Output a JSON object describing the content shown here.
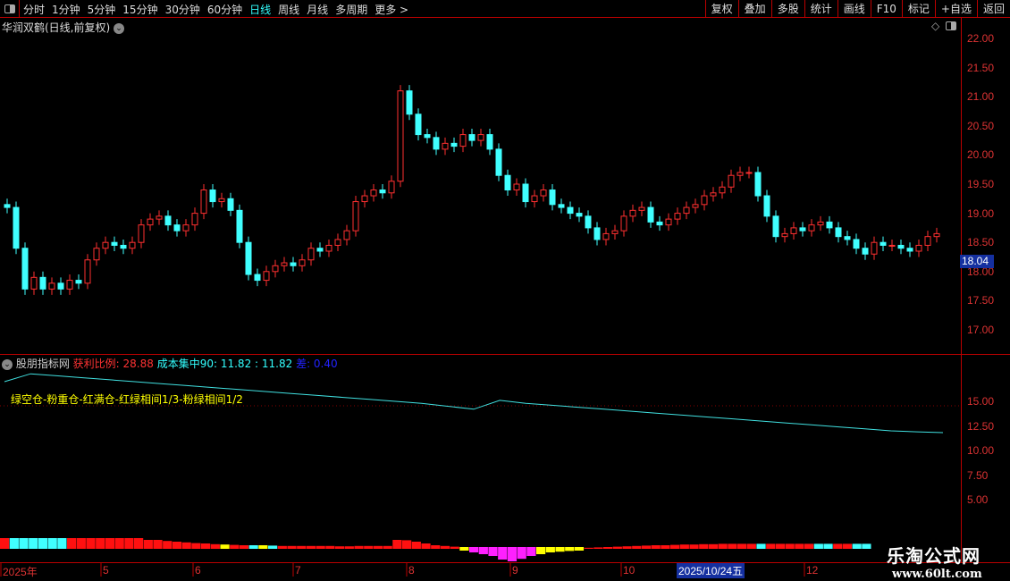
{
  "toolbar": {
    "periods": [
      "分时",
      "1分钟",
      "5分钟",
      "15分钟",
      "30分钟",
      "60分钟",
      "日线",
      "周线",
      "月线",
      "多周期",
      "更多 >"
    ],
    "active": "日线",
    "right_buttons": [
      "复权",
      "叠加",
      "多股",
      "统计",
      "画线",
      "F10",
      "标记",
      "+自选",
      "返回"
    ]
  },
  "stock": {
    "title": "华润双鹤(日线,前复权)",
    "current_price": "18.04"
  },
  "indicator": {
    "name": "股朋指标网",
    "profit_label": "获利比例: 28.88",
    "cost_label": "成本集中90: 11.82 : 11.82",
    "diff_label": "差: 0.40",
    "note": "绿空仓-粉重仓-红满仓-红绿相间1/3-粉绿相间1/2"
  },
  "colors": {
    "up": "#ff3030",
    "down": "#40ffff",
    "axis": "#b00000",
    "line": "#40e0e0",
    "pink": "#ff20ff",
    "yellow": "#ffff00",
    "blue": "#1530a0"
  },
  "chart_data": [
    {
      "type": "candlestick",
      "ylim": [
        16.8,
        22.2
      ],
      "yticks": [
        "22.00",
        "21.50",
        "21.00",
        "20.50",
        "20.00",
        "19.50",
        "19.00",
        "18.50",
        "18.00",
        "17.50",
        "17.00"
      ],
      "closes": [
        19.1,
        18.4,
        17.7,
        17.9,
        17.7,
        17.8,
        17.7,
        17.85,
        17.8,
        18.2,
        18.4,
        18.5,
        18.45,
        18.4,
        18.5,
        18.8,
        18.9,
        18.95,
        18.8,
        18.7,
        18.8,
        19.0,
        19.4,
        19.2,
        19.25,
        19.05,
        18.5,
        17.95,
        17.85,
        18.0,
        18.1,
        18.15,
        18.1,
        18.2,
        18.4,
        18.35,
        18.45,
        18.55,
        18.7,
        19.2,
        19.3,
        19.4,
        19.35,
        19.55,
        21.1,
        20.7,
        20.35,
        20.3,
        20.1,
        20.2,
        20.15,
        20.35,
        20.25,
        20.35,
        20.1,
        19.65,
        19.4,
        19.5,
        19.2,
        19.3,
        19.4,
        19.15,
        19.1,
        19.0,
        18.95,
        18.75,
        18.55,
        18.65,
        18.7,
        18.95,
        19.05,
        19.1,
        18.85,
        18.8,
        18.9,
        19.0,
        19.1,
        19.15,
        19.3,
        19.35,
        19.45,
        19.65,
        19.7,
        19.7,
        19.3,
        18.95,
        18.6,
        18.65,
        18.75,
        18.7,
        18.8,
        18.85,
        18.75,
        18.6,
        18.55,
        18.4,
        18.3,
        18.5,
        18.45,
        18.45,
        18.4,
        18.35,
        18.45,
        18.6,
        18.65
      ]
    },
    {
      "type": "line",
      "ylim": [
        3,
        18
      ],
      "yticks": [
        "15.00",
        "12.50",
        "10.00",
        "7.50",
        "5.00"
      ],
      "values": [
        17.0,
        17.8,
        17.6,
        17.4,
        17.2,
        17.0,
        16.8,
        16.6,
        16.4,
        16.2,
        16.0,
        15.8,
        15.6,
        15.4,
        15.2,
        15.0,
        14.8,
        14.5,
        14.2,
        15.1,
        14.8,
        14.6,
        14.4,
        14.2,
        14.0,
        13.8,
        13.6,
        13.4,
        13.2,
        13.0,
        12.8,
        12.6,
        12.4,
        12.2,
        12.0,
        11.9,
        11.82
      ]
    },
    {
      "type": "bar",
      "colors": [
        "red",
        "cyan",
        "cyan",
        "cyan",
        "cyan",
        "cyan",
        "cyan",
        "red",
        "red",
        "red",
        "red",
        "red",
        "red",
        "red",
        "red",
        "red",
        "red",
        "red",
        "red",
        "red",
        "red",
        "red",
        "red",
        "yellow",
        "red",
        "red",
        "cyan",
        "yellow",
        "cyan",
        "red",
        "red",
        "red",
        "red",
        "red",
        "red",
        "red",
        "red",
        "red",
        "red",
        "red",
        "red",
        "red",
        "red",
        "red",
        "red",
        "red",
        "red",
        "red",
        "yellow",
        "pink",
        "pink",
        "pink",
        "pink",
        "pink",
        "pink",
        "pink",
        "yellow",
        "yellow",
        "yellow",
        "yellow",
        "yellow",
        "red",
        "red",
        "red",
        "red",
        "red",
        "red",
        "red",
        "red",
        "red",
        "red",
        "red",
        "red",
        "red",
        "red",
        "red",
        "red",
        "red",
        "red",
        "cyan",
        "red",
        "red",
        "red",
        "red",
        "red",
        "cyan",
        "cyan",
        "red",
        "red",
        "cyan",
        "cyan",
        "cyan",
        "cyan"
      ],
      "values": [
        3,
        3,
        3,
        3,
        3,
        3,
        3,
        3,
        3,
        3,
        3,
        3,
        3,
        3,
        3,
        2.5,
        2.5,
        2.2,
        2,
        1.8,
        1.6,
        1.5,
        1.3,
        1.2,
        1.1,
        1,
        1,
        1,
        0.9,
        0.8,
        0.8,
        0.8,
        0.8,
        0.8,
        0.8,
        0.7,
        0.7,
        0.8,
        0.8,
        0.8,
        0.8,
        2.5,
        2.4,
        2,
        1.5,
        1,
        0.8,
        0.6,
        -0.5,
        -1,
        -1.5,
        -2,
        -3,
        -3.5,
        -2.8,
        -2,
        -1.5,
        -1,
        -0.8,
        -0.6,
        -0.5,
        0.3,
        0.4,
        0.5,
        0.6,
        0.7,
        0.8,
        0.9,
        1,
        1,
        1.1,
        1.2,
        1.2,
        1.3,
        1.3,
        1.4,
        1.4,
        1.4,
        1.4,
        1.4,
        1.4,
        1.4,
        1.4,
        1.4,
        1.4,
        1.4,
        1.4,
        1.4,
        1.4,
        1.4,
        1.4
      ]
    }
  ],
  "date_axis": {
    "labels": [
      "2025年",
      "5",
      "6",
      "7",
      "8",
      "9",
      "10",
      "12"
    ],
    "selected": "2025/10/24五"
  },
  "watermark": {
    "name": "乐淘公式网",
    "url": "www.60lt.com"
  }
}
